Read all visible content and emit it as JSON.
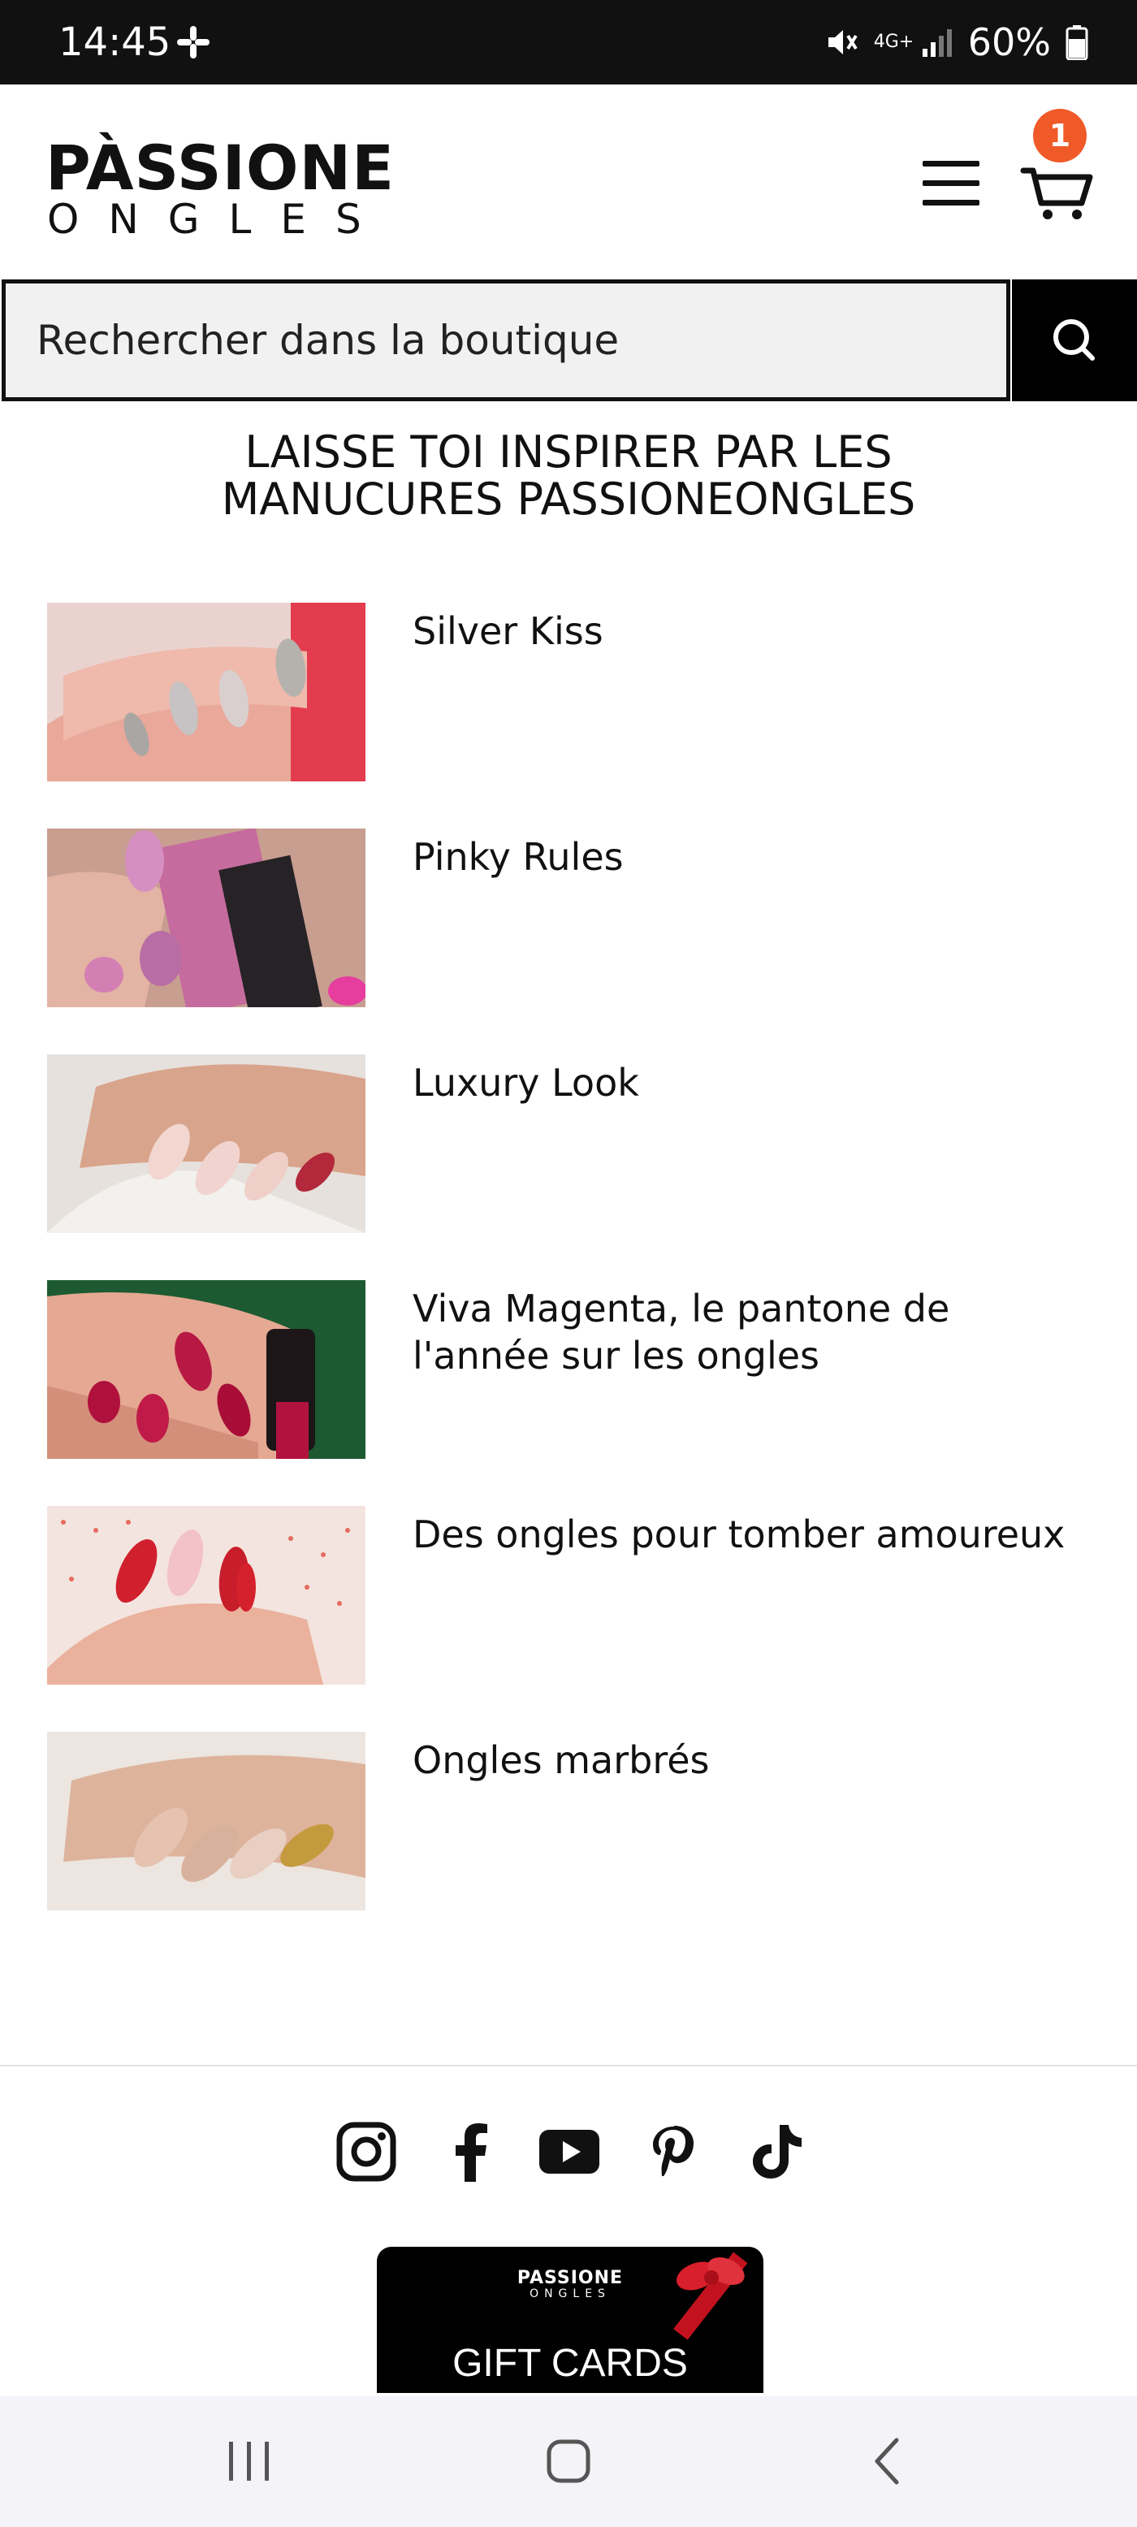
{
  "status_bar": {
    "time": "14:45",
    "network": "4G+",
    "battery": "60%"
  },
  "header": {
    "logo_line1": "PÀSSIONE",
    "logo_line2": "ONGLES",
    "cart_count": "1",
    "badge_color": "#f05a28"
  },
  "search": {
    "placeholder": "Rechercher dans la boutique"
  },
  "section": {
    "title_line1": "LAISSE TOI INSPIRER PAR LES",
    "title_line2": "MANUCURES PASSIONEONGLES"
  },
  "articles": [
    {
      "title": "Silver Kiss",
      "image": "silver-nails-photo"
    },
    {
      "title": "Pinky Rules",
      "image": "pink-glitter-nails-photo"
    },
    {
      "title": "Luxury Look",
      "image": "nude-nails-photo"
    },
    {
      "title": "Viva Magenta, le pantone de l'année sur les ongles",
      "image": "magenta-nails-photo"
    },
    {
      "title": "Des ongles pour tomber amoureux",
      "image": "heart-nails-photo"
    },
    {
      "title": "Ongles marbrés",
      "image": "marble-nails-photo"
    }
  ],
  "footer": {
    "socials": [
      "instagram-icon",
      "facebook-icon",
      "youtube-icon",
      "pinterest-icon",
      "tiktok-icon"
    ],
    "giftcard": {
      "brand_line1": "PASSIONE",
      "brand_line2": "ONGLES",
      "label": "GIFT CARDS"
    }
  },
  "nav": [
    "recent-apps",
    "home",
    "back"
  ]
}
